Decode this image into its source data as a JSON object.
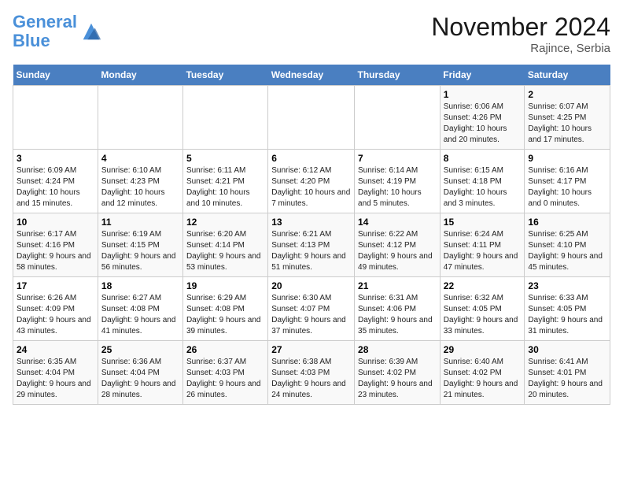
{
  "logo": {
    "line1": "General",
    "line2": "Blue"
  },
  "title": "November 2024",
  "location": "Rajince, Serbia",
  "days_header": [
    "Sunday",
    "Monday",
    "Tuesday",
    "Wednesday",
    "Thursday",
    "Friday",
    "Saturday"
  ],
  "weeks": [
    [
      {
        "num": "",
        "info": ""
      },
      {
        "num": "",
        "info": ""
      },
      {
        "num": "",
        "info": ""
      },
      {
        "num": "",
        "info": ""
      },
      {
        "num": "",
        "info": ""
      },
      {
        "num": "1",
        "info": "Sunrise: 6:06 AM\nSunset: 4:26 PM\nDaylight: 10 hours and 20 minutes."
      },
      {
        "num": "2",
        "info": "Sunrise: 6:07 AM\nSunset: 4:25 PM\nDaylight: 10 hours and 17 minutes."
      }
    ],
    [
      {
        "num": "3",
        "info": "Sunrise: 6:09 AM\nSunset: 4:24 PM\nDaylight: 10 hours and 15 minutes."
      },
      {
        "num": "4",
        "info": "Sunrise: 6:10 AM\nSunset: 4:23 PM\nDaylight: 10 hours and 12 minutes."
      },
      {
        "num": "5",
        "info": "Sunrise: 6:11 AM\nSunset: 4:21 PM\nDaylight: 10 hours and 10 minutes."
      },
      {
        "num": "6",
        "info": "Sunrise: 6:12 AM\nSunset: 4:20 PM\nDaylight: 10 hours and 7 minutes."
      },
      {
        "num": "7",
        "info": "Sunrise: 6:14 AM\nSunset: 4:19 PM\nDaylight: 10 hours and 5 minutes."
      },
      {
        "num": "8",
        "info": "Sunrise: 6:15 AM\nSunset: 4:18 PM\nDaylight: 10 hours and 3 minutes."
      },
      {
        "num": "9",
        "info": "Sunrise: 6:16 AM\nSunset: 4:17 PM\nDaylight: 10 hours and 0 minutes."
      }
    ],
    [
      {
        "num": "10",
        "info": "Sunrise: 6:17 AM\nSunset: 4:16 PM\nDaylight: 9 hours and 58 minutes."
      },
      {
        "num": "11",
        "info": "Sunrise: 6:19 AM\nSunset: 4:15 PM\nDaylight: 9 hours and 56 minutes."
      },
      {
        "num": "12",
        "info": "Sunrise: 6:20 AM\nSunset: 4:14 PM\nDaylight: 9 hours and 53 minutes."
      },
      {
        "num": "13",
        "info": "Sunrise: 6:21 AM\nSunset: 4:13 PM\nDaylight: 9 hours and 51 minutes."
      },
      {
        "num": "14",
        "info": "Sunrise: 6:22 AM\nSunset: 4:12 PM\nDaylight: 9 hours and 49 minutes."
      },
      {
        "num": "15",
        "info": "Sunrise: 6:24 AM\nSunset: 4:11 PM\nDaylight: 9 hours and 47 minutes."
      },
      {
        "num": "16",
        "info": "Sunrise: 6:25 AM\nSunset: 4:10 PM\nDaylight: 9 hours and 45 minutes."
      }
    ],
    [
      {
        "num": "17",
        "info": "Sunrise: 6:26 AM\nSunset: 4:09 PM\nDaylight: 9 hours and 43 minutes."
      },
      {
        "num": "18",
        "info": "Sunrise: 6:27 AM\nSunset: 4:08 PM\nDaylight: 9 hours and 41 minutes."
      },
      {
        "num": "19",
        "info": "Sunrise: 6:29 AM\nSunset: 4:08 PM\nDaylight: 9 hours and 39 minutes."
      },
      {
        "num": "20",
        "info": "Sunrise: 6:30 AM\nSunset: 4:07 PM\nDaylight: 9 hours and 37 minutes."
      },
      {
        "num": "21",
        "info": "Sunrise: 6:31 AM\nSunset: 4:06 PM\nDaylight: 9 hours and 35 minutes."
      },
      {
        "num": "22",
        "info": "Sunrise: 6:32 AM\nSunset: 4:05 PM\nDaylight: 9 hours and 33 minutes."
      },
      {
        "num": "23",
        "info": "Sunrise: 6:33 AM\nSunset: 4:05 PM\nDaylight: 9 hours and 31 minutes."
      }
    ],
    [
      {
        "num": "24",
        "info": "Sunrise: 6:35 AM\nSunset: 4:04 PM\nDaylight: 9 hours and 29 minutes."
      },
      {
        "num": "25",
        "info": "Sunrise: 6:36 AM\nSunset: 4:04 PM\nDaylight: 9 hours and 28 minutes."
      },
      {
        "num": "26",
        "info": "Sunrise: 6:37 AM\nSunset: 4:03 PM\nDaylight: 9 hours and 26 minutes."
      },
      {
        "num": "27",
        "info": "Sunrise: 6:38 AM\nSunset: 4:03 PM\nDaylight: 9 hours and 24 minutes."
      },
      {
        "num": "28",
        "info": "Sunrise: 6:39 AM\nSunset: 4:02 PM\nDaylight: 9 hours and 23 minutes."
      },
      {
        "num": "29",
        "info": "Sunrise: 6:40 AM\nSunset: 4:02 PM\nDaylight: 9 hours and 21 minutes."
      },
      {
        "num": "30",
        "info": "Sunrise: 6:41 AM\nSunset: 4:01 PM\nDaylight: 9 hours and 20 minutes."
      }
    ]
  ]
}
